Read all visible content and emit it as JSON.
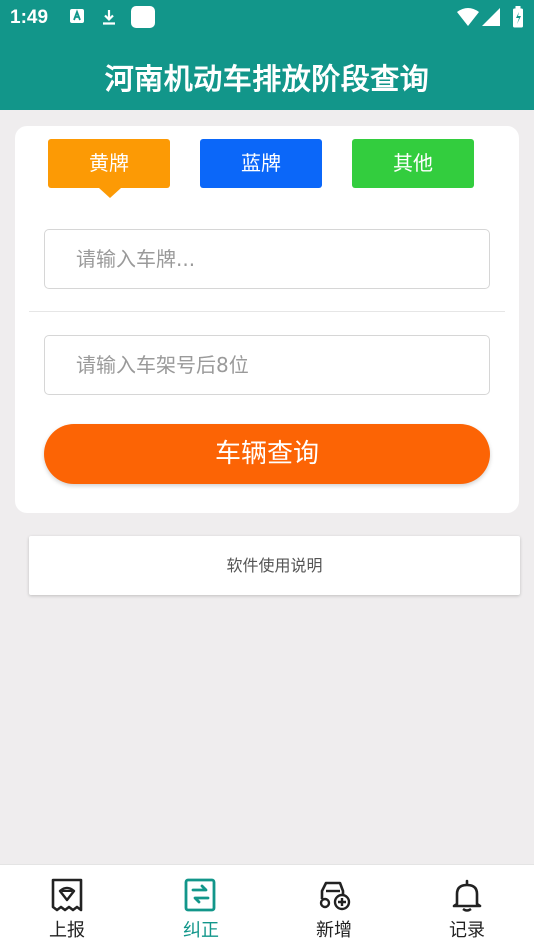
{
  "status_bar": {
    "time": "1:49"
  },
  "app_bar": {
    "title": "河南机动车排放阶段查询"
  },
  "plate_tabs": [
    {
      "label": "黄牌",
      "color": "#fc9a05",
      "selected": true
    },
    {
      "label": "蓝牌",
      "color": "#0b67f9",
      "selected": false
    },
    {
      "label": "其他",
      "color": "#33cd3e",
      "selected": false
    }
  ],
  "plate_input": {
    "value": "",
    "placeholder": "请输入车牌..."
  },
  "vin_input": {
    "value": "",
    "placeholder": "请输入车架号后8位"
  },
  "query_button": {
    "label": "车辆查询",
    "color": "#fc6405"
  },
  "help_link": {
    "label": "软件使用说明"
  },
  "bottom_nav": [
    {
      "label": "上报",
      "icon": "report-icon",
      "active": false
    },
    {
      "label": "纠正",
      "icon": "correct-icon",
      "active": true
    },
    {
      "label": "新增",
      "icon": "add-vehicle-icon",
      "active": false
    },
    {
      "label": "记录",
      "icon": "bell-icon",
      "active": false
    }
  ],
  "colors": {
    "primary": "#12968a",
    "background": "#efedee"
  }
}
